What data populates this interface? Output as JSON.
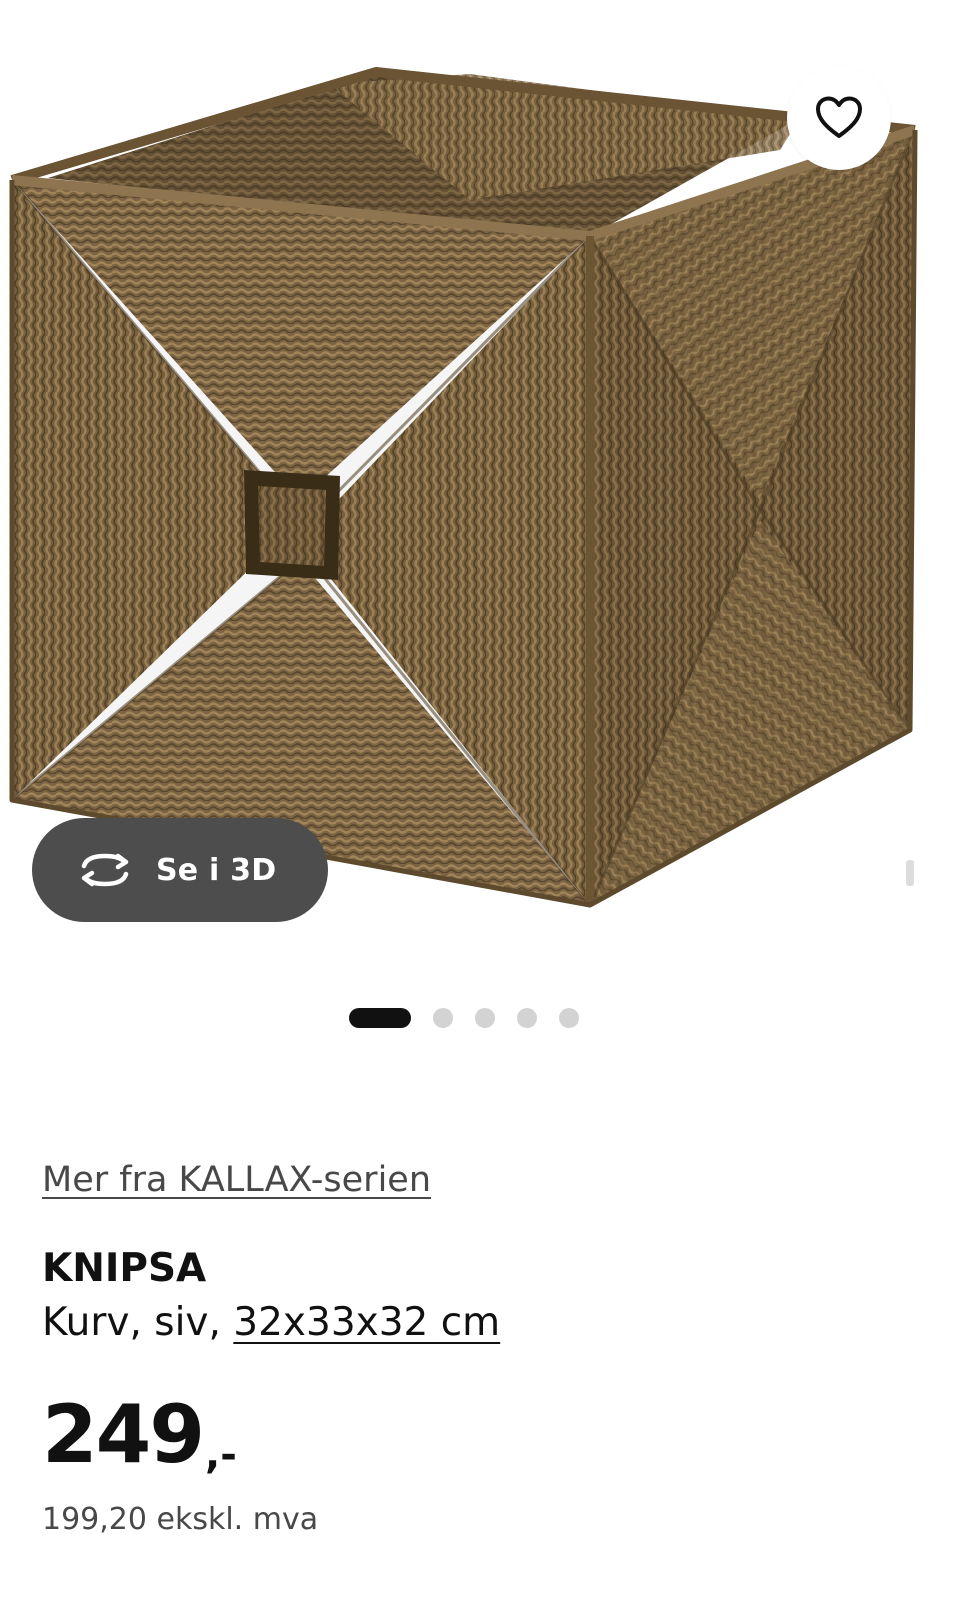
{
  "gallery": {
    "image_alt": "KNIPSA kurv",
    "view_3d_label": "Se i 3D",
    "slide_count": 5,
    "active_slide": 1,
    "favorite_icon": "heart-outline-icon",
    "rotate_icon": "rotate-3d-icon"
  },
  "product": {
    "series_link": "Mer fra KALLAX-serien",
    "name": "KNIPSA",
    "description_prefix": "Kurv, siv, ",
    "measurement": "32x33x32 cm",
    "price_amount": "249",
    "price_suffix": ",-",
    "price_excl_vat": "199,20 ekskl. mva"
  },
  "colors": {
    "wicker": "#7a6442",
    "button_dark": "#4d4d4d",
    "dot_active": "#111111",
    "dot_inactive": "#d3d3d3"
  }
}
